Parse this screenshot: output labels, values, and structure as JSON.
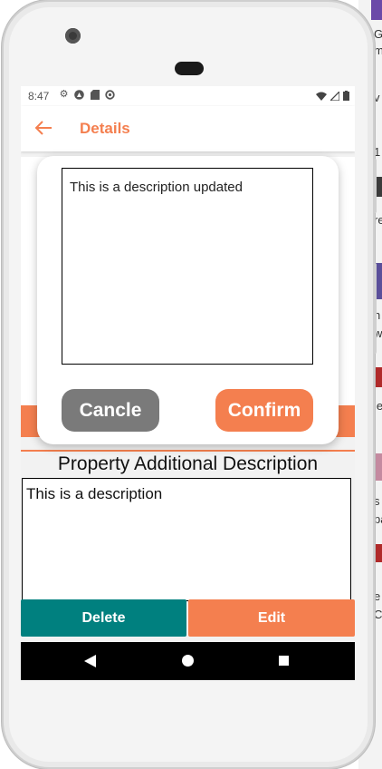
{
  "status_bar": {
    "time": "8:47"
  },
  "app_bar": {
    "title": "Details"
  },
  "dialog": {
    "description_value": "This is a description updated",
    "cancel_label": "Cancle",
    "confirm_label": "Confirm"
  },
  "section": {
    "title": "Property Additional Description",
    "description": "This is a description"
  },
  "actions": {
    "delete_label": "Delete",
    "edit_label": "Edit"
  },
  "background": {
    "side_text": [
      "G",
      "m",
      "'",
      "1",
      "re",
      "v",
      "n",
      "w",
      "ie",
      "s",
      "pa",
      "e",
      "Ci"
    ]
  },
  "colors": {
    "accent": "#f47f4f",
    "teal": "#00807f",
    "gray_button": "#7a7a7a"
  }
}
